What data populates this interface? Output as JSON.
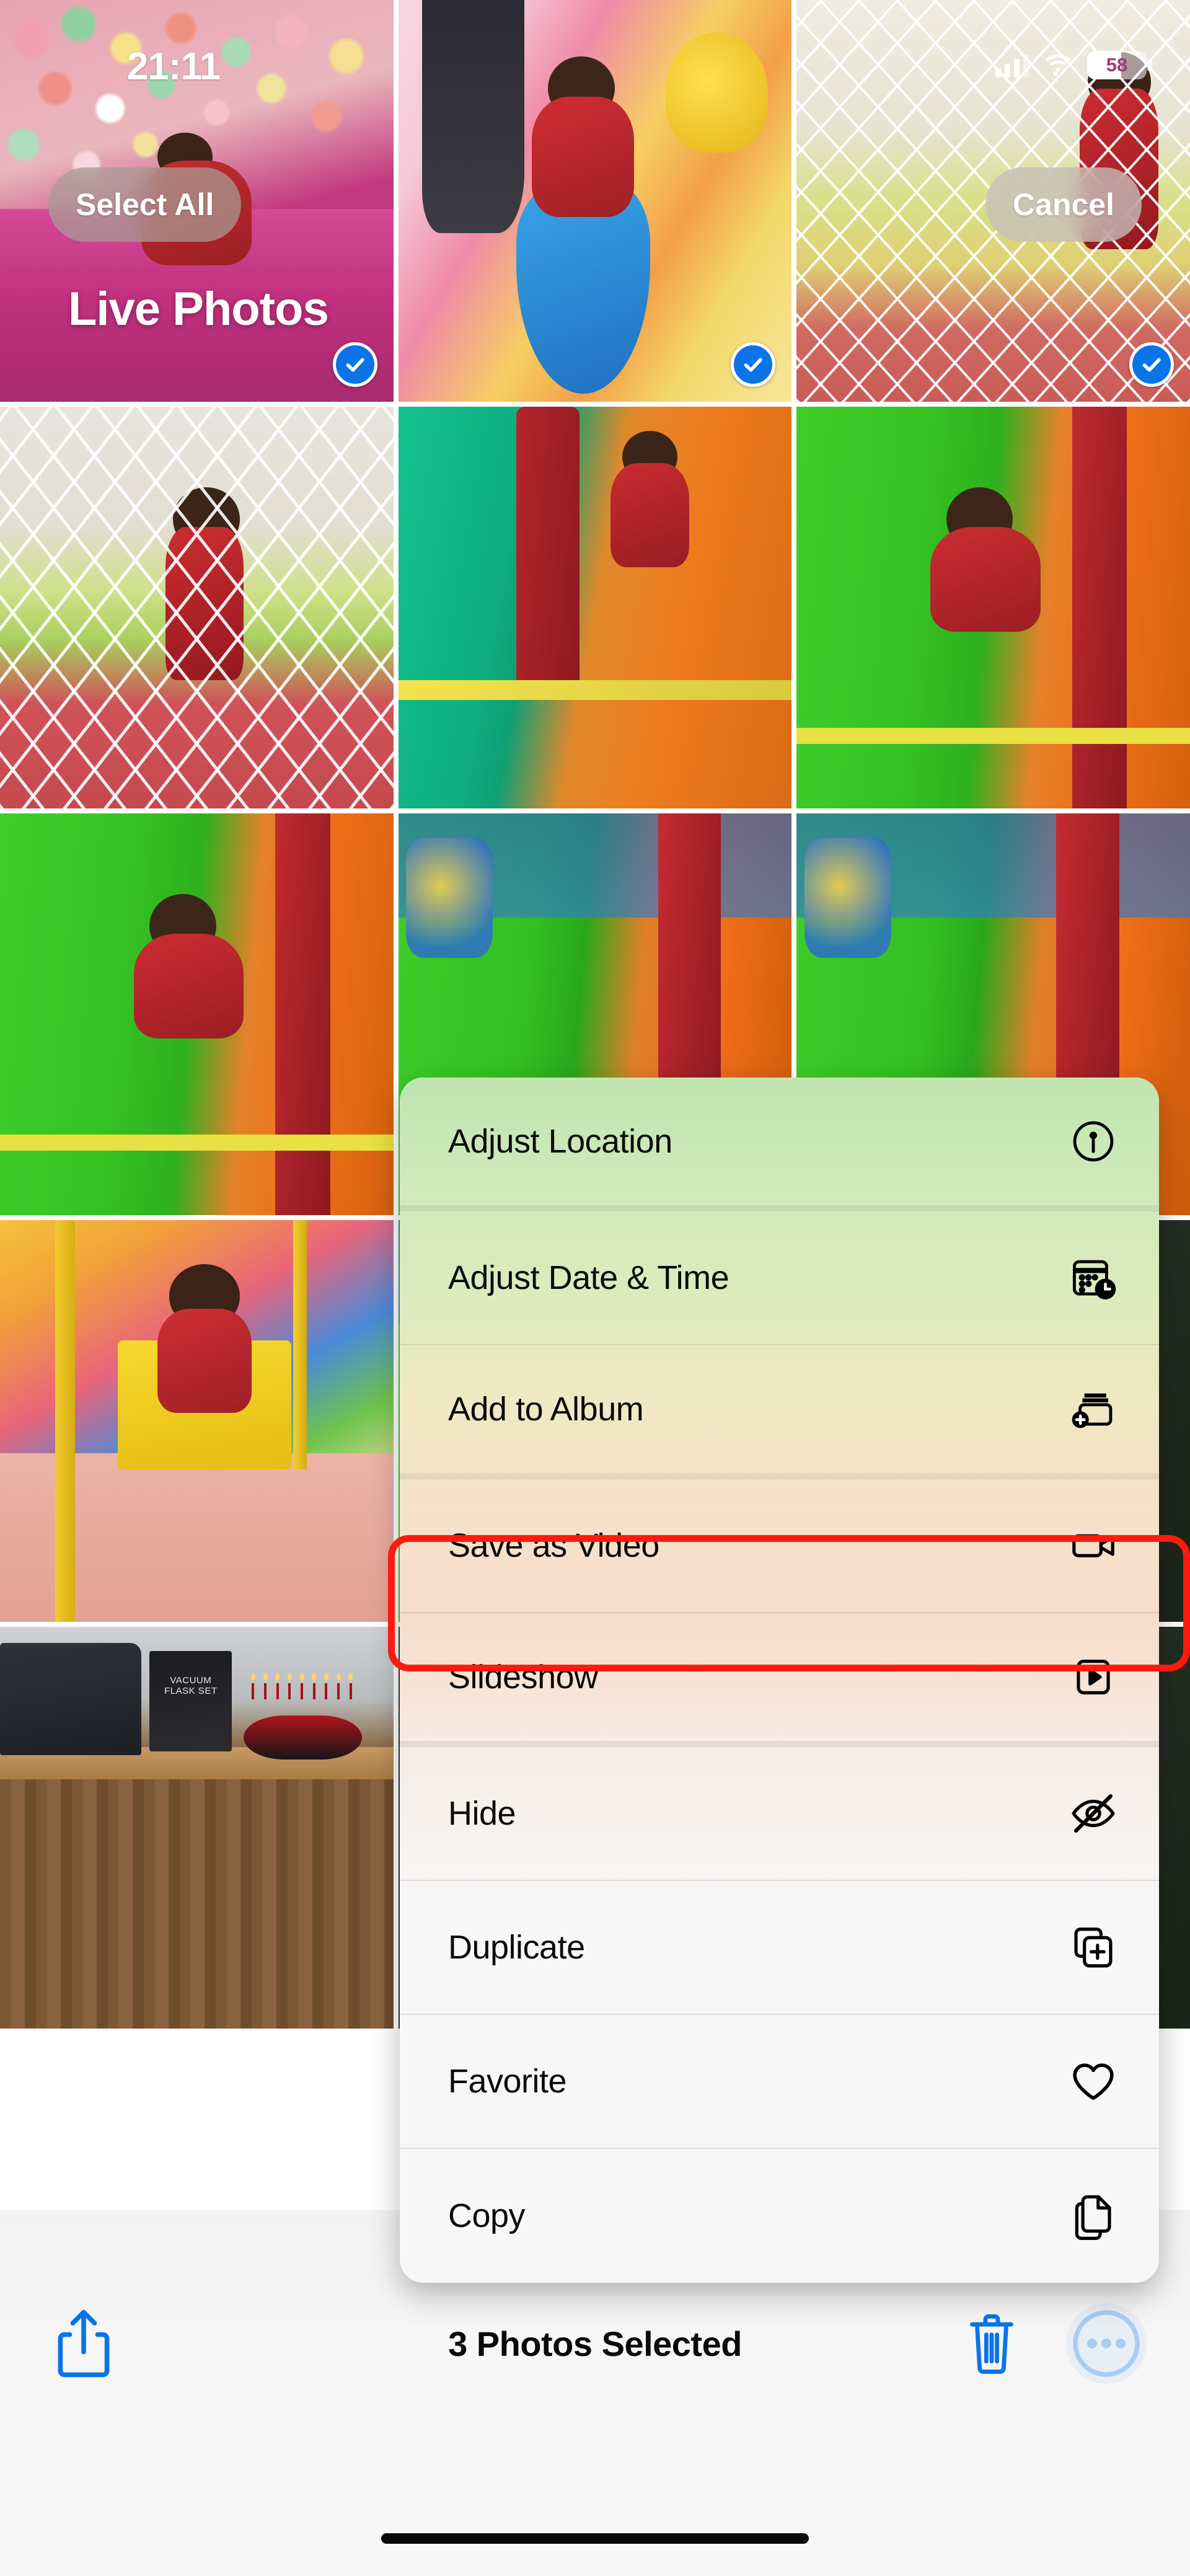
{
  "status_bar": {
    "time": "21:11",
    "signal_icon": "cellular-signal-icon",
    "signal_bars_filled": 3,
    "signal_bars_total": 4,
    "wifi_icon": "wifi-icon",
    "battery_percent": "58",
    "battery_level": 58,
    "battery_icon": "battery-icon"
  },
  "header": {
    "select_all_label": "Select All",
    "cancel_label": "Cancel",
    "album_title": "Live Photos"
  },
  "grid": {
    "columns": 3,
    "selected_checkmark_icon": "checkmark-circle-icon",
    "photos": [
      {
        "id": "p1",
        "art": "ballpit",
        "alt": "Toddler in red top lying in a colourful ball pit",
        "selected": true
      },
      {
        "id": "p2",
        "art": "foam",
        "alt": "Toddler riding a blue rocker on foam play mats",
        "selected": true
      },
      {
        "id": "p3",
        "art": "netplay",
        "alt": "Toddler behind white safety netting in play area",
        "selected": true
      },
      {
        "id": "p4",
        "art": "netplay2",
        "alt": "Toddler standing behind play-area net",
        "selected": false
      },
      {
        "id": "p5",
        "art": "bounce",
        "alt": "Toddler at the top of an inflatable slide",
        "selected": false
      },
      {
        "id": "p6",
        "art": "slidegreen",
        "alt": "Toddler climbing a green inflatable slide",
        "selected": false
      },
      {
        "id": "p7",
        "art": "slidegreen",
        "alt": "Toddler lying on green inflatable slide",
        "selected": false
      },
      {
        "id": "p8",
        "art": "slidetop",
        "alt": "Green and red inflatable slide",
        "selected": false
      },
      {
        "id": "p9",
        "art": "slidetop",
        "alt": "Green inflatable slide close up",
        "selected": false
      },
      {
        "id": "p10",
        "art": "swing",
        "alt": "Toddler laughing on a yellow swing seat",
        "selected": false
      },
      {
        "id": "p11",
        "art": "slidetop",
        "alt": "Inflatable slide detail",
        "selected": false
      },
      {
        "id": "p12",
        "art": "dark-green",
        "alt": "Dark play-area photo",
        "selected": false
      },
      {
        "id": "p13",
        "art": "cake",
        "alt": "Birthday cake with lit candles on a wooden counter",
        "selected": false
      },
      {
        "id": "p14",
        "art": "dark-green",
        "alt": "Dark photo",
        "selected": false
      },
      {
        "id": "p15",
        "art": "dark-green",
        "alt": "Dark photo",
        "selected": false
      }
    ]
  },
  "context_menu": {
    "items": [
      {
        "label": "Adjust Location",
        "icon": "location-info-icon",
        "group_end": true,
        "highlighted": false
      },
      {
        "label": "Adjust Date & Time",
        "icon": "calendar-clock-icon",
        "group_end": false,
        "highlighted": false
      },
      {
        "label": "Add to Album",
        "icon": "add-to-album-icon",
        "group_end": true,
        "highlighted": false
      },
      {
        "label": "Save as Video",
        "icon": "video-camera-icon",
        "group_end": false,
        "highlighted": true
      },
      {
        "label": "Slideshow",
        "icon": "play-rect-icon",
        "group_end": true,
        "highlighted": false
      },
      {
        "label": "Hide",
        "icon": "eye-slash-icon",
        "group_end": false,
        "highlighted": false
      },
      {
        "label": "Duplicate",
        "icon": "duplicate-icon",
        "group_end": false,
        "highlighted": false
      },
      {
        "label": "Favorite",
        "icon": "heart-icon",
        "group_end": false,
        "highlighted": false
      },
      {
        "label": "Copy",
        "icon": "copy-icon",
        "group_end": false,
        "highlighted": false
      }
    ],
    "highlight_color": "#ff1a0d"
  },
  "toolbar": {
    "share_icon": "share-icon",
    "selection_count_label": "3 Photos Selected",
    "delete_icon": "trash-icon",
    "more_icon": "more-ellipsis-icon",
    "accent_color": "#0a74e8"
  },
  "cake_photo": {
    "bag_text_line1": "VACUUM",
    "bag_text_line2": "FLASK SET"
  }
}
